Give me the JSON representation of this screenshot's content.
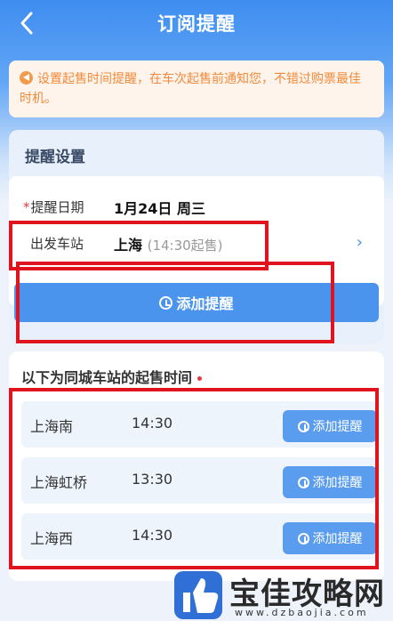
{
  "header": {
    "title": "订阅提醒",
    "back_icon": "back-chevron-icon"
  },
  "notice": {
    "text": "设置起售时间提醒，在车次起售前通知您，不错过购票最佳时机。",
    "icon": "horn-icon"
  },
  "settings": {
    "title": "提醒设置",
    "date_required_mark": "*",
    "date_label": "提醒日期",
    "date_value": "1月24日 周三",
    "station_label": "出发车站",
    "station_value": "上海",
    "station_sale_time": "(14:30起售)",
    "chevron": "›",
    "add_button_label": "添加提醒"
  },
  "stations": {
    "title": "以下为同城车站的起售时间",
    "items": [
      {
        "name": "上海南",
        "time": "14:30",
        "button": "添加提醒"
      },
      {
        "name": "上海虹桥",
        "time": "13:30",
        "button": "添加提醒"
      },
      {
        "name": "上海西",
        "time": "14:30",
        "button": "添加提醒"
      }
    ]
  },
  "watermark": {
    "name": "宝佳攻略网",
    "url": "www.dzbaojia.com"
  },
  "colors": {
    "primary": "#4b94ee",
    "notice_text": "#f08a3a",
    "highlight_box": "#e0141e"
  }
}
